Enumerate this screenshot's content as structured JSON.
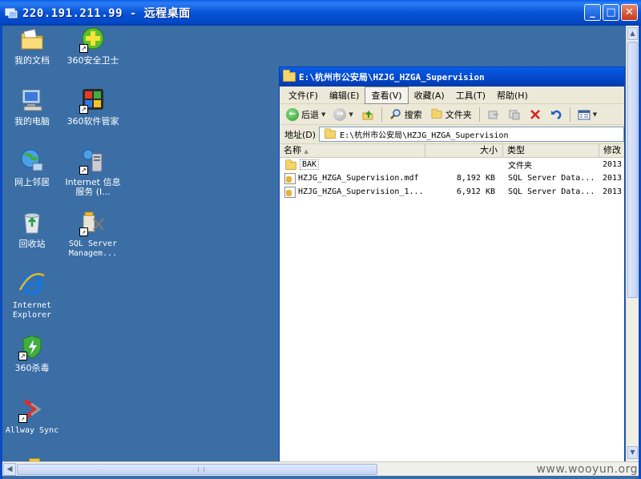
{
  "remote_desktop": {
    "title": "220.191.211.99 - 远程桌面",
    "buttons": {
      "minimize": "_",
      "maximize": "□",
      "close": "✕"
    }
  },
  "desktop_icons": [
    {
      "id": "my-documents",
      "label": "我的文档",
      "icon": "folder-documents-icon"
    },
    {
      "id": "360-safe",
      "label": "360安全卫士",
      "icon": "360-safe-icon"
    },
    {
      "id": "my-computer",
      "label": "我的电脑",
      "icon": "computer-icon"
    },
    {
      "id": "360-softmgr",
      "label": "360软件管家",
      "icon": "360-software-manager-icon"
    },
    {
      "id": "network",
      "label": "网上邻居",
      "icon": "network-icon"
    },
    {
      "id": "iis",
      "label": "Internet 信息服务 (I...",
      "icon": "iis-icon"
    },
    {
      "id": "recycle-bin",
      "label": "回收站",
      "icon": "recycle-bin-icon"
    },
    {
      "id": "sql-mgmt",
      "label": "SQL Server Managem...",
      "icon": "sql-server-icon"
    },
    {
      "id": "ie",
      "label": "Internet Explorer",
      "icon": "internet-explorer-icon"
    },
    {
      "id": "360-av",
      "label": "360杀毒",
      "icon": "360-antivirus-icon"
    },
    {
      "id": "allway",
      "label": "Allway Sync",
      "icon": "allway-sync-icon"
    }
  ],
  "explorer": {
    "title": "E:\\杭州市公安局\\HZJG_HZGA_Supervision",
    "menu": [
      "文件(F)",
      "编辑(E)",
      "查看(V)",
      "收藏(A)",
      "工具(T)",
      "帮助(H)"
    ],
    "active_menu": "查看(V)",
    "toolbar": {
      "back": "后退",
      "search": "搜索",
      "folders": "文件夹"
    },
    "address_label": "地址(D)",
    "address_value": "E:\\杭州市公安局\\HZJG_HZGA_Supervision",
    "columns": {
      "name": "名称",
      "size": "大小",
      "type": "类型",
      "modified": "修改"
    },
    "files": [
      {
        "name": "BAK",
        "size": "",
        "type": "文件夹",
        "modified": "2013",
        "kind": "folder"
      },
      {
        "name": "HZJG_HZGA_Supervision.mdf",
        "size": "8,192 KB",
        "type": "SQL Server Data...",
        "modified": "2013",
        "kind": "db"
      },
      {
        "name": "HZJG_HZGA_Supervision_1...",
        "size": "6,912 KB",
        "type": "SQL Server Data...",
        "modified": "2013",
        "kind": "db"
      }
    ]
  },
  "watermark": "www.wooyun.org",
  "colors": {
    "desktop": "#3a6ea5",
    "titlebar": "#0752d8",
    "close": "#c5381a"
  }
}
